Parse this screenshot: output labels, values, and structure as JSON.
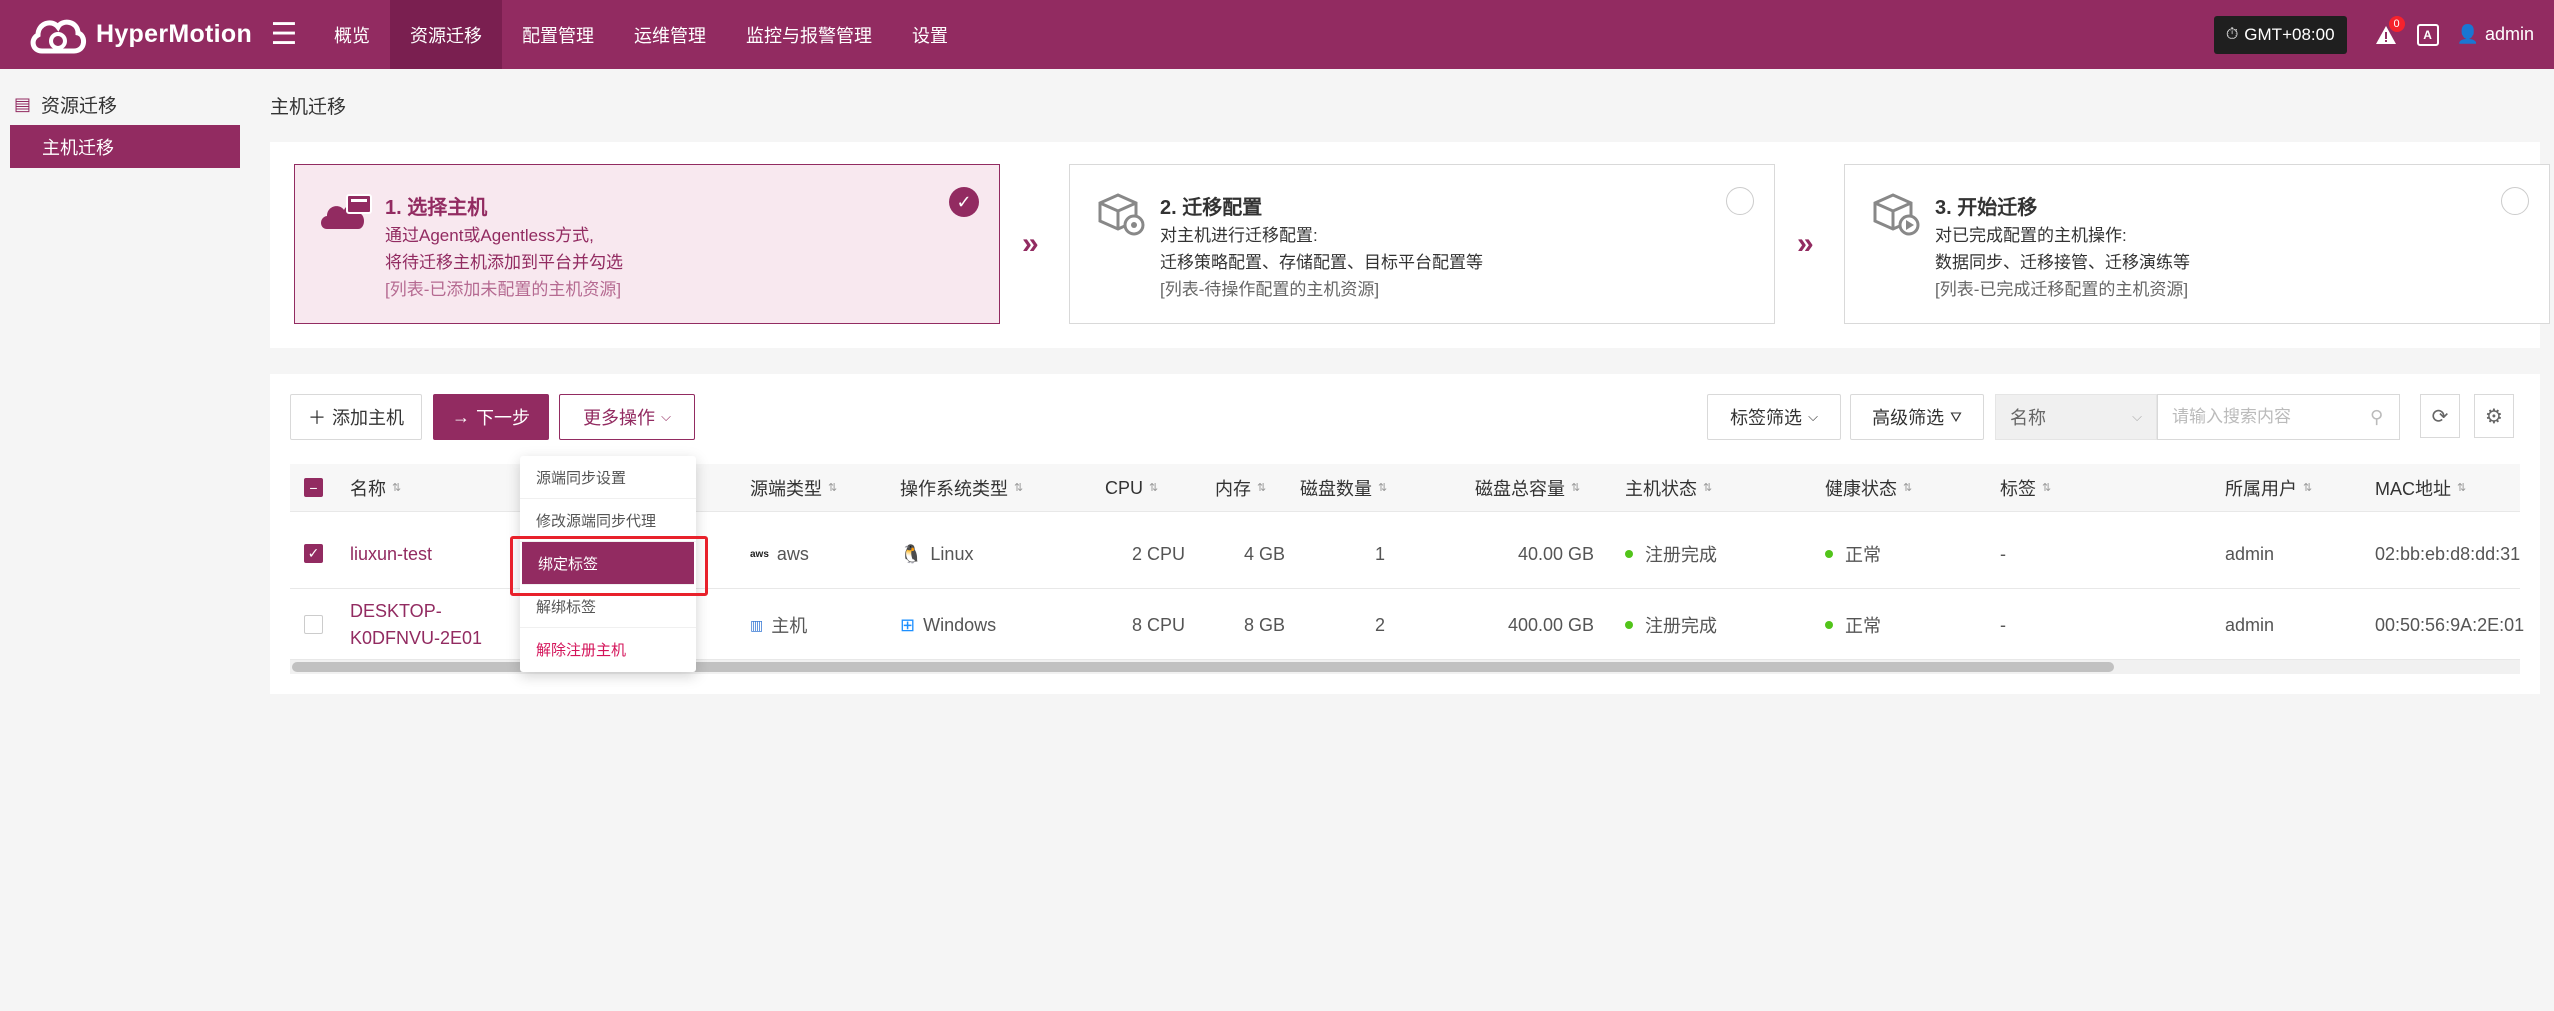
{
  "app": {
    "brand": "HyperMotion",
    "nav": [
      "概览",
      "资源迁移",
      "配置管理",
      "运维管理",
      "监控与报警管理",
      "设置"
    ],
    "active_nav": "资源迁移",
    "timezone": "GMT+08:00",
    "alert_count": "0",
    "lang_icon": "A",
    "user": "admin",
    "accent_color": "#922b61"
  },
  "sidebar": {
    "group": "资源迁移",
    "items": [
      {
        "label": "主机迁移",
        "active": true
      }
    ]
  },
  "page": {
    "title": "主机迁移"
  },
  "steps": [
    {
      "title": "1. 选择主机",
      "line1": "通过Agent或Agentless方式,",
      "line2": "将待迁移主机添加到平台并勾选",
      "line3": "[列表-已添加未配置的主机资源]",
      "icon": "cloud-host-icon"
    },
    {
      "title": "2. 迁移配置",
      "line1": "对主机进行迁移配置:",
      "line2": "迁移策略配置、存储配置、目标平台配置等",
      "line3": "[列表-待操作配置的主机资源]",
      "icon": "box-gear-icon"
    },
    {
      "title": "3. 开始迁移",
      "line1": "对已完成配置的主机操作:",
      "line2": "数据同步、迁移接管、迁移演练等",
      "line3": "[列表-已完成迁移配置的主机资源]",
      "icon": "box-play-icon"
    }
  ],
  "toolbar": {
    "add_host": "添加主机",
    "next_step": "下一步",
    "more_ops": "更多操作",
    "tag_filter": "标签筛选",
    "advanced_filter": "高级筛选",
    "search_field": "名称",
    "search_placeholder": "请输入搜索内容"
  },
  "more_menu": [
    "源端同步设置",
    "修改源端同步代理",
    "绑定标签",
    "解绑标签",
    "解除注册主机"
  ],
  "more_menu_highlighted": "绑定标签",
  "table": {
    "columns": [
      "名称",
      "源端类型",
      "操作系统类型",
      "CPU",
      "内存",
      "磁盘数量",
      "磁盘总容量",
      "主机状态",
      "健康状态",
      "标签",
      "所属用户",
      "MAC地址"
    ],
    "rows": [
      {
        "checked": true,
        "name_l1": "liuxun-test",
        "name_l2": "",
        "source": "aws",
        "source_icon": "aws-icon",
        "os": "Linux",
        "os_icon": "linux-icon",
        "cpu": "2 CPU",
        "mem": "4 GB",
        "disks": "1",
        "capacity": "40.00 GB",
        "status": "注册完成",
        "health": "正常",
        "tags": "-",
        "owner": "admin",
        "mac": "02:bb:eb:d8:dd:31"
      },
      {
        "checked": false,
        "name_l1": "DESKTOP-",
        "name_l2": "K0DFNVU-2E01",
        "source": "主机",
        "source_icon": "host-icon",
        "os": "Windows",
        "os_icon": "windows-icon",
        "cpu": "8 CPU",
        "mem": "8 GB",
        "disks": "2",
        "capacity": "400.00 GB",
        "status": "注册完成",
        "health": "正常",
        "tags": "-",
        "owner": "admin",
        "mac": "00:50:56:9A:2E:01"
      }
    ]
  }
}
